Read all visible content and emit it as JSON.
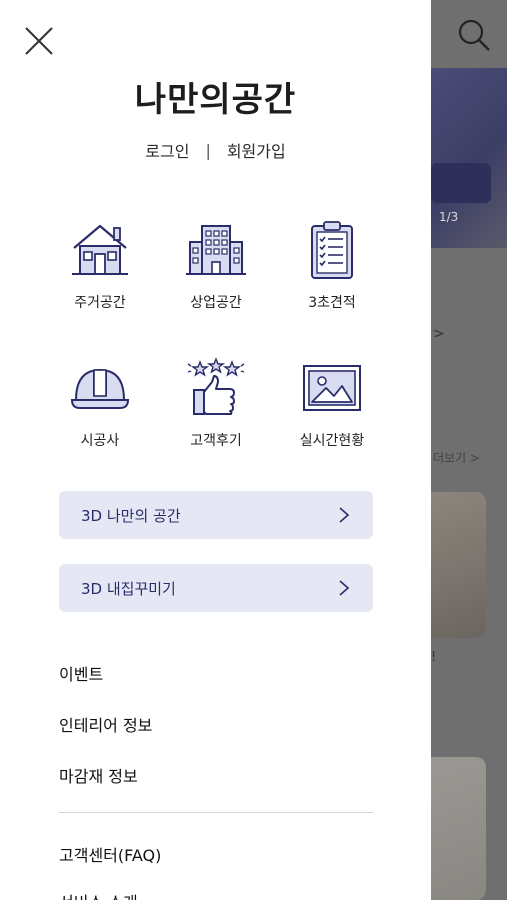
{
  "background": {
    "counter": "1/3",
    "more_link": "더보기 >",
    "arrow": ">",
    "excl": "!"
  },
  "drawer": {
    "logo": "나만의공간",
    "auth": {
      "login": "로그인",
      "separator": "|",
      "signup": "회원가입"
    },
    "categories": [
      {
        "label": "주거공간",
        "icon": "house-icon"
      },
      {
        "label": "상업공간",
        "icon": "building-icon"
      },
      {
        "label": "3초견적",
        "icon": "clipboard-icon"
      },
      {
        "label": "시공사",
        "icon": "hardhat-icon"
      },
      {
        "label": "고객후기",
        "icon": "thumbs-up-stars-icon"
      },
      {
        "label": "실시간현황",
        "icon": "picture-frame-icon"
      }
    ],
    "banners": [
      {
        "label": "3D 나만의 공간"
      },
      {
        "label": "3D 내집꾸미기"
      }
    ],
    "menu": [
      "이벤트",
      "인테리어 정보",
      "마감재 정보",
      "고객센터(FAQ)",
      "서비스 소개"
    ]
  },
  "colors": {
    "accent": "#2b2d6a",
    "pill_bg": "#e5e8f4",
    "icon_fill": "#d9dcf0",
    "overlay": "#6f6f6f"
  }
}
